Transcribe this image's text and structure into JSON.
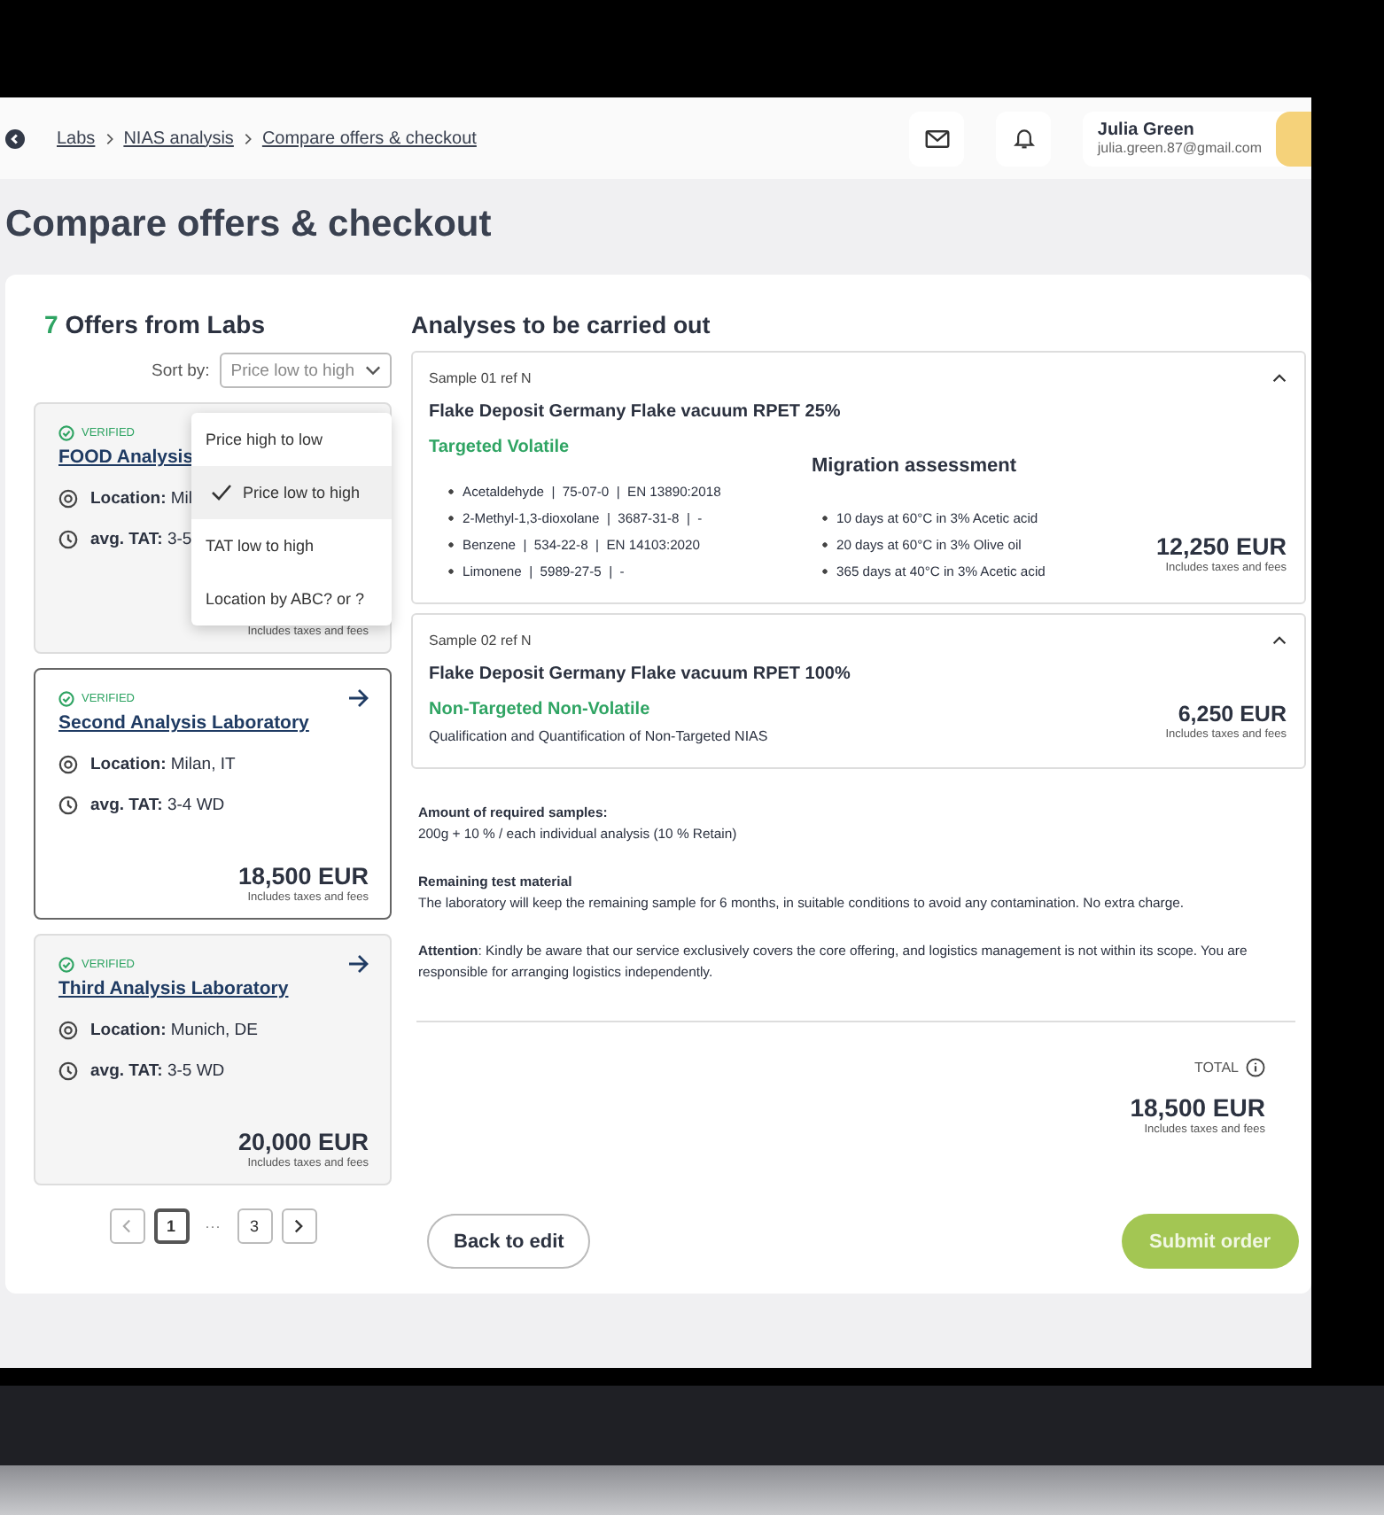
{
  "breadcrumb": [
    {
      "label": "Labs"
    },
    {
      "label": "NIAS analysis"
    },
    {
      "label": "Compare offers & checkout"
    }
  ],
  "user": {
    "name": "Julia Green",
    "email": "julia.green.87@gmail.com"
  },
  "page_title": "Compare offers & checkout",
  "offers": {
    "count": "7",
    "title": "Offers from Labs",
    "sort_label": "Sort by:",
    "sort_value": "Price low to high",
    "sort_options": [
      {
        "label": "Price high to low",
        "selected": false
      },
      {
        "label": "Price low to high",
        "selected": true
      },
      {
        "label": "TAT low to high",
        "selected": false
      },
      {
        "label": "Location by ABC? or ?",
        "selected": false
      }
    ],
    "labs": [
      {
        "badge": "VERIFIED",
        "name": "FOOD Analysis",
        "location_label": "Location:",
        "location": "Mil",
        "tat_label": "avg. TAT:",
        "tat": "3-5",
        "price_note": "Includes taxes and fees",
        "selected": false
      },
      {
        "badge": "VERIFIED",
        "name": "Second Analysis Laboratory",
        "location_label": "Location:",
        "location": "Milan, IT",
        "tat_label": "avg. TAT:",
        "tat": "3-4 WD",
        "price": "18,500 EUR",
        "price_note": "Includes taxes and fees",
        "selected": true,
        "arrow": true
      },
      {
        "badge": "VERIFIED",
        "name": "Third Analysis Laboratory",
        "location_label": "Location:",
        "location": "Munich, DE",
        "tat_label": "avg. TAT:",
        "tat": "3-5 WD",
        "price": "20,000 EUR",
        "price_note": "Includes taxes and fees",
        "selected": false,
        "arrow": true
      }
    ],
    "pagination": {
      "prev_disabled": true,
      "next_disabled": false,
      "items": [
        {
          "kind": "page",
          "label": "1",
          "selected": true
        },
        {
          "kind": "ellipsis",
          "label": "···"
        },
        {
          "kind": "page",
          "label": "3",
          "selected": false
        }
      ]
    }
  },
  "analyses": {
    "title": "Analyses to be carried out",
    "samples": [
      {
        "kind": "targeted",
        "ref": "Sample 01 ref N",
        "name": "Flake Deposit Germany Flake vacuum RPET 25%",
        "analysis": "Targeted Volatile",
        "expanded": true,
        "substances": [
          "Acetaldehyde  |  75-07-0  |  EN 13890:2018",
          "2-Methyl-1,3-dioxolane  |  3687-31-8  |  -",
          "Benzene  |  534-22-8  |  EN 14103:2020",
          "Limonene  |  5989-27-5  |  -"
        ],
        "migration_title": "Migration assessment",
        "migration": [
          "10 days at 60°C in 3% Acetic acid",
          "20 days at 60°C in 3% Olive oil",
          "365 days at 40°C in 3% Acetic acid"
        ],
        "price": "12,250 EUR",
        "price_note": "Includes taxes and fees"
      },
      {
        "kind": "non_targeted",
        "ref": "Sample 02 ref N",
        "name": "Flake Deposit Germany Flake vacuum RPET 100%",
        "analysis": "Non-Targeted Non-Volatile",
        "expanded": true,
        "description": "Qualification and Quantification of Non-Targeted NIAS",
        "price": "6,250 EUR",
        "price_note": "Includes taxes and fees"
      }
    ],
    "notes": [
      {
        "heading": "Amount of required samples:",
        "text": "200g  + 10 % / each individual analysis (10 % Retain)"
      },
      {
        "heading": "Remaining test material",
        "text": "The laboratory will keep the remaining sample for 6 months, in suitable conditions to avoid any contamination. No extra charge."
      },
      {
        "text": "**Attention**: Kindly be aware that our service exclusively covers the core offering, and logistics management is not within its scope. You are responsible for arranging logistics independently."
      }
    ],
    "total_label": "TOTAL",
    "total": "18,500 EUR",
    "total_note": "Includes taxes and fees"
  },
  "buttons": {
    "back": "Back to edit",
    "submit": "Submit order"
  }
}
